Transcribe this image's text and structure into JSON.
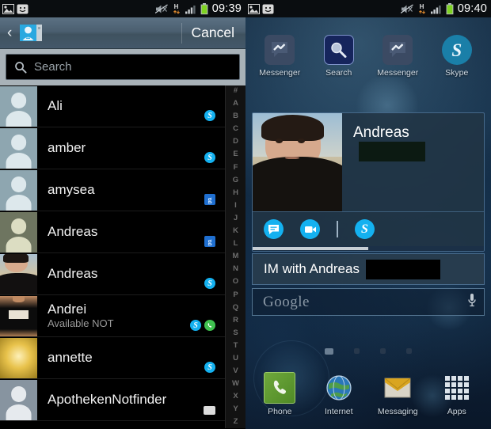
{
  "left_phone": {
    "status_bar": {
      "time": "09:39",
      "icons": [
        "image-icon",
        "messenger-notification-icon",
        "mute-icon",
        "hsdpa-data-icon",
        "signal-bars-icon",
        "battery-icon"
      ]
    },
    "title_bar": {
      "back_label": "‹",
      "app_icon_name": "skype-contact-icon",
      "cancel_label": "Cancel"
    },
    "search": {
      "placeholder": "Search",
      "icon": "search-icon"
    },
    "contacts": [
      {
        "name": "Ali",
        "status": "",
        "avatar": "generic-blue",
        "badges": [
          "skype"
        ]
      },
      {
        "name": "amber",
        "status": "",
        "avatar": "generic-blue",
        "badges": [
          "skype"
        ]
      },
      {
        "name": "amysea",
        "status": "",
        "avatar": "generic-blue",
        "badges": [
          "gtalk"
        ]
      },
      {
        "name": "Andreas",
        "status": "",
        "avatar": "generic-olive",
        "badges": [
          "gtalk"
        ]
      },
      {
        "name": "Andreas",
        "status": "",
        "avatar": "photo-man",
        "badges": [
          "skype"
        ]
      },
      {
        "name": "Andrei",
        "status": "Available NOT",
        "avatar": "photo-tshirt",
        "badges": [
          "skype",
          "whatsapp"
        ]
      },
      {
        "name": "annette",
        "status": "",
        "avatar": "photo-gold",
        "badges": [
          "skype"
        ]
      },
      {
        "name": "ApothekenNotfinder",
        "status": "",
        "avatar": "generic-gray",
        "badges": [
          "sim"
        ]
      }
    ],
    "alpha_index": [
      "#",
      "A",
      "B",
      "C",
      "D",
      "E",
      "F",
      "G",
      "H",
      "I",
      "J",
      "K",
      "L",
      "M",
      "N",
      "O",
      "P",
      "Q",
      "R",
      "S",
      "T",
      "U",
      "V",
      "W",
      "X",
      "Y",
      "Z"
    ]
  },
  "right_phone": {
    "status_bar": {
      "time": "09:40",
      "icons": [
        "image-icon",
        "messenger-notification-icon",
        "mute-icon",
        "hsdpa-data-icon",
        "signal-bars-icon",
        "battery-icon"
      ]
    },
    "app_icons": [
      {
        "label": "Messenger",
        "icon": "messenger-icon"
      },
      {
        "label": "Search",
        "icon": "search-app-icon"
      },
      {
        "label": "Messenger",
        "icon": "messenger-icon"
      },
      {
        "label": "Skype",
        "icon": "skype-icon"
      }
    ],
    "contact_widget": {
      "name": "Andreas",
      "name_redacted": true,
      "photo": "contact-photo",
      "actions": [
        {
          "icon": "chat-bubble-icon"
        },
        {
          "icon": "video-call-icon"
        },
        {
          "icon": "divider"
        },
        {
          "icon": "skype-icon"
        }
      ]
    },
    "im_bar": {
      "text": "IM with Andreas",
      "redacted": true
    },
    "google_search": {
      "label": "Google",
      "mic_icon": "microphone-icon"
    },
    "page_dots": {
      "count": 4,
      "active_index": 0
    },
    "dock": [
      {
        "label": "Phone",
        "icon": "phone-icon"
      },
      {
        "label": "Internet",
        "icon": "globe-icon"
      },
      {
        "label": "Messaging",
        "icon": "envelope-icon"
      },
      {
        "label": "Apps",
        "icon": "apps-grid-icon"
      }
    ]
  },
  "colors": {
    "skype_blue": "#14b1f0",
    "whatsapp_green": "#3fc14f",
    "gtalk_blue": "#1f6fd0",
    "battery_green": "#7ed321",
    "titlebar": "#4b5f70"
  }
}
